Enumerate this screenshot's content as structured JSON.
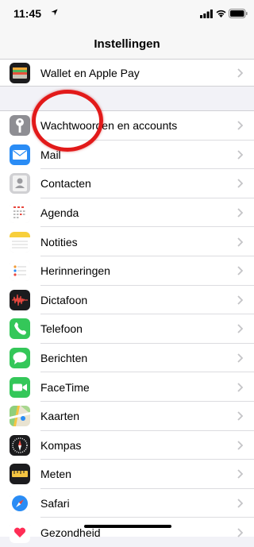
{
  "status_bar": {
    "time": "11:45"
  },
  "nav": {
    "title": "Instellingen"
  },
  "group1": [
    {
      "label": "Wallet en Apple Pay",
      "icon": "wallet-icon",
      "color": "#1c1c1e"
    }
  ],
  "group2": [
    {
      "label": "Wachtwoorden en accounts",
      "icon": "key-icon",
      "color": "#8e8e93"
    },
    {
      "label": "Mail",
      "icon": "mail-icon",
      "color": "#2a8cf5"
    },
    {
      "label": "Contacten",
      "icon": "contacts-icon",
      "color": "#b9b9bd"
    },
    {
      "label": "Agenda",
      "icon": "calendar-icon",
      "color": "#ffffff"
    },
    {
      "label": "Notities",
      "icon": "notes-icon",
      "color": "#ffffff"
    },
    {
      "label": "Herinneringen",
      "icon": "reminders-icon",
      "color": "#ffffff"
    },
    {
      "label": "Dictafoon",
      "icon": "voice-memos-icon",
      "color": "#1c1c1e"
    },
    {
      "label": "Telefoon",
      "icon": "phone-icon",
      "color": "#34c759"
    },
    {
      "label": "Berichten",
      "icon": "messages-icon",
      "color": "#34c759"
    },
    {
      "label": "FaceTime",
      "icon": "facetime-icon",
      "color": "#34c759"
    },
    {
      "label": "Kaarten",
      "icon": "maps-icon",
      "color": "#8fcf7c"
    },
    {
      "label": "Kompas",
      "icon": "compass-icon",
      "color": "#1c1c1e"
    },
    {
      "label": "Meten",
      "icon": "measure-icon",
      "color": "#1c1c1e"
    },
    {
      "label": "Safari",
      "icon": "safari-icon",
      "color": "#ffffff"
    },
    {
      "label": "Gezondheid",
      "icon": "health-icon",
      "color": "#ffffff"
    }
  ]
}
